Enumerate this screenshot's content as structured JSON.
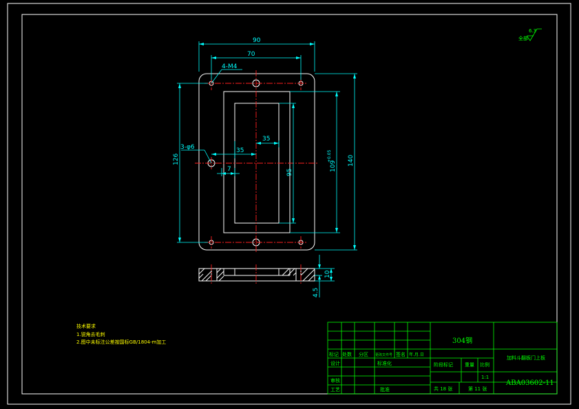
{
  "dimensions": {
    "width_90": "90",
    "width_70": "70",
    "tap_holes": "4-M4",
    "height_126": "126",
    "holes_6": "3-φ6",
    "dim_35_upper": "35",
    "dim_35_lower": "35",
    "dim_7": "7",
    "dim_95": "95",
    "dim_109": "109",
    "tolerance": "+0.05",
    "height_140": "140",
    "thickness_10": "10",
    "step_45": "4.5"
  },
  "surface_finish": {
    "value": "6.3",
    "label": "全部"
  },
  "notes": {
    "title": "技术要求",
    "line1": "1.锐角去毛刺",
    "line2": "2.图中未标注公差按国标GB/1804-m加工"
  },
  "title_block": {
    "material": "304钢",
    "part_name": "加料斗翻板门上板",
    "drawing_no": "ABA03602-11",
    "scale": "1:1",
    "sheet_total": "共 18 张",
    "sheet_no": "第 11 张",
    "r_biaoji": "标记",
    "r_chushu": "处数",
    "r_fenqu": "分区",
    "r_gengai": "更改文件号",
    "r_qianming": "签名",
    "r_date": "年.月.日",
    "r_sheji": "设计",
    "r_biaozhunhua": "标准化",
    "r_jieduan": "阶段标记",
    "r_zhongliang": "重量",
    "r_bili": "比例",
    "r_shenhe": "审核",
    "r_gongyi": "工艺",
    "r_pizhun": "批准"
  }
}
